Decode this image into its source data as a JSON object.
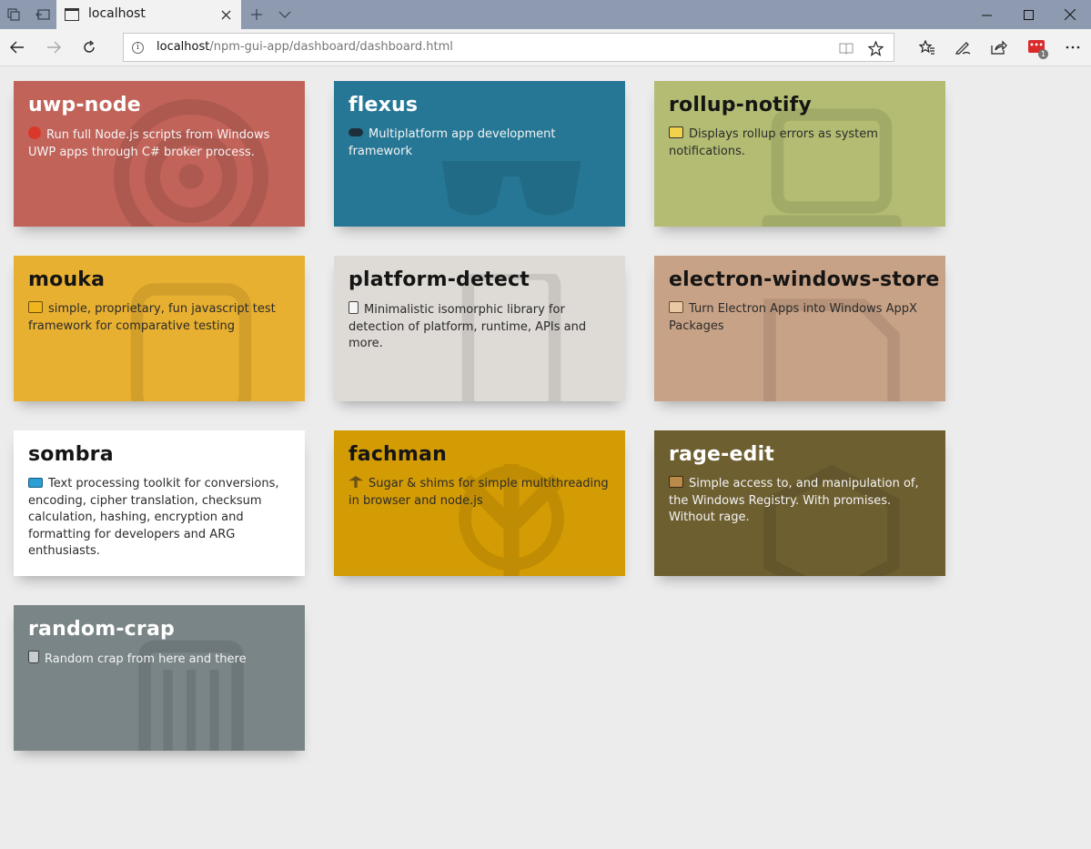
{
  "browser": {
    "tab": {
      "title": "localhost"
    },
    "address": {
      "host": "localhost",
      "path": "/npm-gui-app/dashboard/dashboard.html"
    },
    "extension_badge": {
      "label": "•••",
      "count": "1"
    }
  },
  "cards": [
    {
      "title": "uwp-node",
      "description": "Run full Node.js scripts from Windows UWP apps through C# broker process.",
      "color": "#c16359",
      "emoji_icon": "target-icon"
    },
    {
      "title": "flexus",
      "description": "Multiplatform app development framework",
      "color": "#267795",
      "emoji_icon": "glasses-icon"
    },
    {
      "title": "rollup-notify",
      "description": "Displays rollup errors as system notifications.",
      "color": "#b3bc72",
      "emoji_icon": "laptop-icon"
    },
    {
      "title": "mouka",
      "description": "simple, proprietary, fun javascript test framework for comparative testing",
      "color": "#e8b030",
      "emoji_icon": "notebook-icon"
    },
    {
      "title": "platform-detect",
      "description": "Minimalistic isomorphic library for detection of platform, runtime, APIs and more.",
      "color": "#dedad6",
      "emoji_icon": "phone-icon"
    },
    {
      "title": "electron-windows-store",
      "description": "Turn Electron Apps into Windows AppX Packages",
      "color": "#c8a286",
      "emoji_icon": "package-icon"
    },
    {
      "title": "sombra",
      "description": "Text processing toolkit for conversions, encoding, cipher translation, checksum calculation, hashing, encryption and formatting for developers and ARG enthusiasts.",
      "color": "#ffffff",
      "emoji_icon": "keyboard-icon"
    },
    {
      "title": "fachman",
      "description": "Sugar & shims for simple multithreading in browser and node.js",
      "color": "#d39b04",
      "emoji_icon": "fork-icon"
    },
    {
      "title": "rage-edit",
      "description": "Simple access to, and manipulation of, the Windows Registry. With promises. Without rage.",
      "color": "#6e5f31",
      "emoji_icon": "box-icon"
    },
    {
      "title": "random-crap",
      "description": "Random crap from here and there",
      "color": "#7a8587",
      "emoji_icon": "trash-icon"
    }
  ]
}
